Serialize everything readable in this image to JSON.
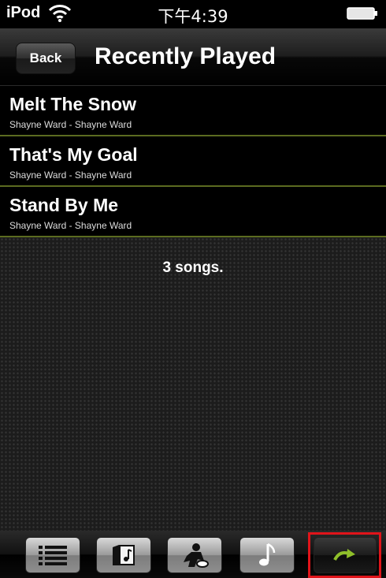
{
  "status_bar": {
    "carrier": "iPod",
    "time": "下午4:39",
    "wifi_icon": "wifi-icon",
    "battery_icon": "battery-icon"
  },
  "nav_bar": {
    "back_label": "Back",
    "title": "Recently Played"
  },
  "songs": [
    {
      "title": "Melt The Snow",
      "subtitle": "Shayne Ward - Shayne Ward"
    },
    {
      "title": "That's My Goal",
      "subtitle": "Shayne Ward - Shayne Ward"
    },
    {
      "title": "Stand By Me",
      "subtitle": "Shayne Ward - Shayne Ward"
    }
  ],
  "song_count": "3 songs.",
  "tab_bar": {
    "tabs": [
      {
        "icon": "list-icon"
      },
      {
        "icon": "album-icon"
      },
      {
        "icon": "artist-icon"
      },
      {
        "icon": "music-note-icon"
      },
      {
        "icon": "repeat-arrow-icon",
        "selected": true
      }
    ],
    "highlight_color": "#e0141a"
  },
  "colors": {
    "row_separator": "#5b6b20",
    "background": "#000000"
  }
}
